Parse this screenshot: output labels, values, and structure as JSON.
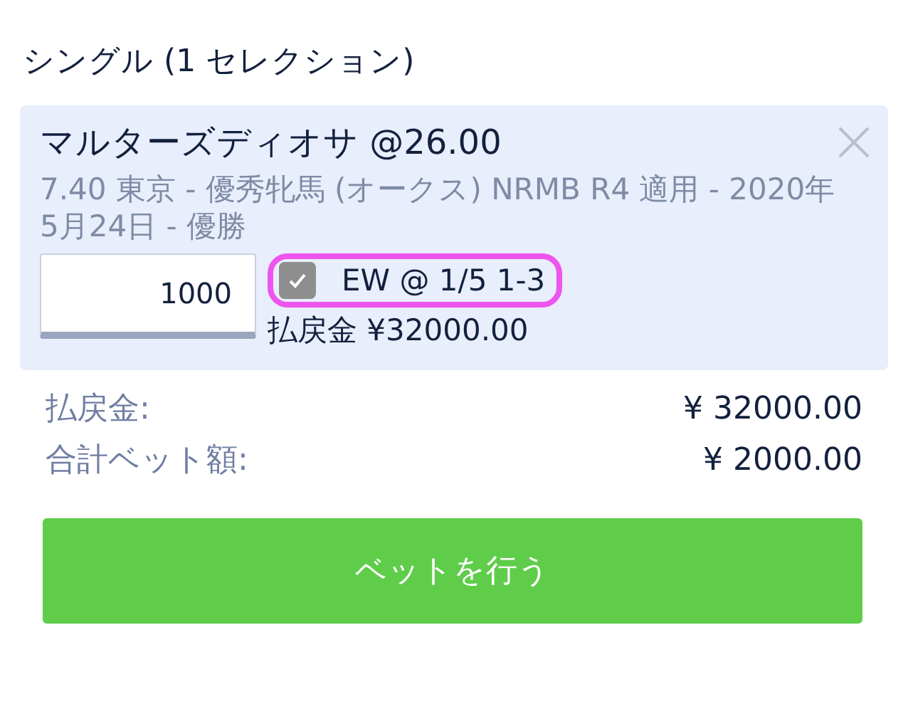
{
  "heading": "シングル (1 セレクション)",
  "selection": {
    "title": "マルターズディオサ @26.00",
    "detail": "7.40 東京 - 優秀牝馬 (オークス) NRMB R4 適用 - 2020年5月24日 - 優勝",
    "stake": "1000",
    "each_way": {
      "label": "EW @ 1/5 1-3",
      "checked": true
    },
    "returns": "払戻金 ¥32000.00"
  },
  "summary": [
    {
      "label": "払戻金:",
      "value": "¥ 32000.00"
    },
    {
      "label": "合計ベット額:",
      "value": "¥ 2000.00"
    }
  ],
  "place_bet_button": "ベットを行う"
}
